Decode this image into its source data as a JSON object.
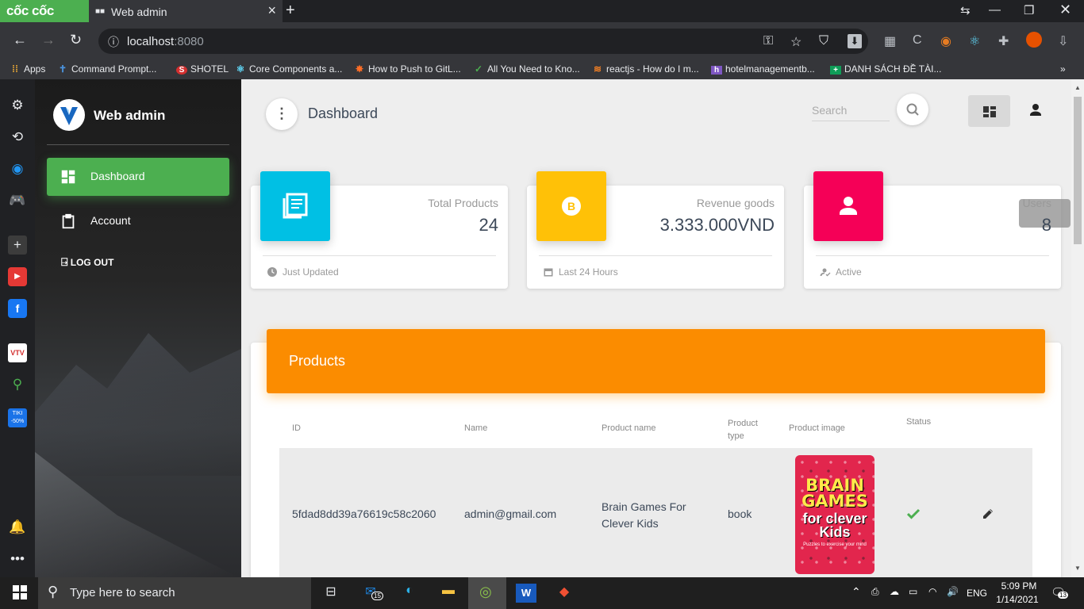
{
  "browser": {
    "brand": "cốc cốc",
    "tab_title": "Web admin",
    "url_host": "localhost",
    "url_port": ":8080",
    "bookmarks": [
      "Apps",
      "Command Prompt...",
      "SHOTEL",
      "Core Components a...",
      "How to Push to GitL...",
      "All You Need to Kno...",
      "reactjs - How do I m...",
      "hotelmanagementb...",
      "DANH SÁCH ĐỀ TÀI..."
    ]
  },
  "nav": {
    "brand": "Web admin",
    "items": [
      {
        "label": "Dashboard"
      },
      {
        "label": "Account"
      }
    ],
    "logout": "LOG OUT"
  },
  "header": {
    "title": "Dashboard",
    "search_placeholder": "Search"
  },
  "stats": [
    {
      "category": "Total Products",
      "value": "24",
      "footer": "Just Updated",
      "color": "#00c0e4"
    },
    {
      "category": "Revenue goods",
      "value": "3.333.000VND",
      "footer": "Last 24 Hours",
      "color": "#ffc107"
    },
    {
      "category": "Users",
      "value": "8",
      "footer": "Active",
      "color": "#f50057"
    }
  ],
  "products": {
    "title": "Products",
    "columns": [
      "ID",
      "Name",
      "Product name",
      "Product type",
      "Product image",
      "Status"
    ],
    "rows": [
      {
        "id": "5fdad8dd39a76619c58c2060",
        "name": "admin@gmail.com",
        "product_name": "Brain Games For Clever Kids",
        "product_type": "book",
        "image_title": "BRAIN GAMES",
        "image_subtitle": "for clever Kids",
        "image_tagline": "Puzzles to exercise your mind"
      }
    ]
  },
  "taskbar": {
    "search_placeholder": "Type here to search",
    "time": "5:09 PM",
    "date": "1/14/2021",
    "lang": "ENG",
    "mail_badge": "15",
    "notif_badge": "13"
  }
}
